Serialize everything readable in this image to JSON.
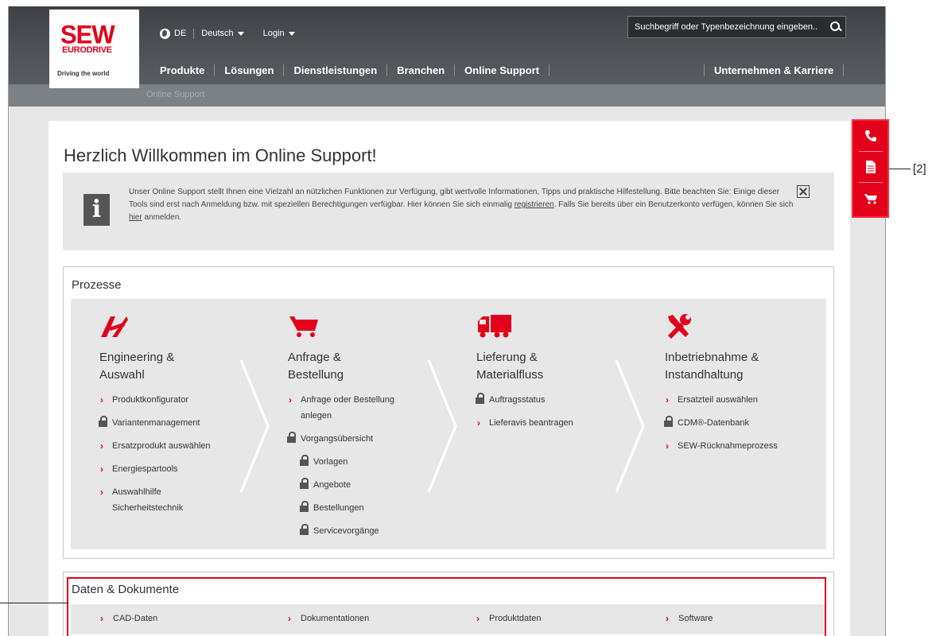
{
  "header": {
    "logo": {
      "brand": "SEW",
      "sub": "EURODRIVE",
      "tagline": "Driving the world"
    },
    "language_code": "DE",
    "language_label": "Deutsch",
    "login_label": "Login",
    "search_placeholder": "Suchbegriff oder Typenbezeichnung eingeben..",
    "nav": [
      "Produkte",
      "Lösungen",
      "Dienstleistungen",
      "Branchen",
      "Online Support"
    ],
    "nav_right": "Unternehmen & Karriere"
  },
  "breadcrumb": "Online Support",
  "side_tools": {
    "callout": "[2]",
    "icons": [
      "phone-icon",
      "document-icon",
      "cart-icon"
    ]
  },
  "main": {
    "title": "Herzlich Willkommen im Online Support!",
    "info": {
      "text_1": "Unser Online Support stellt Ihnen eine Vielzahl an nützlichen Funktionen zur Verfügung, gibt wertvolle Informationen, Tipps und praktische Hilfestellung. Bitte beachten Sie: Einige dieser Tools sind erst nach Anmeldung bzw. mit speziellen Berechtigungen verfügbar. Hier können Sie sich einmalig ",
      "link_register": "registrieren",
      "text_2": ". Falls Sie bereits über ein Benutzerkonto verfügen, können Sie sich ",
      "link_here": "hier",
      "text_3": " anmelden."
    },
    "processes": {
      "heading": "Prozesse",
      "columns": [
        {
          "title_1": "Engineering &",
          "title_2": "Auswahl",
          "items": [
            {
              "label": "Produktkonfigurator",
              "locked": false
            },
            {
              "label": "Variantenmanagement",
              "locked": true
            },
            {
              "label": "Ersatzprodukt auswählen",
              "locked": false
            },
            {
              "label": "Energiespartools",
              "locked": false
            },
            {
              "label": "Auswahlhilfe Sicherheitstechnik",
              "locked": false
            }
          ]
        },
        {
          "title_1": "Anfrage &",
          "title_2": "Bestellung",
          "items": [
            {
              "label": "Anfrage oder Bestellung anlegen",
              "locked": false
            },
            {
              "label": "Vorgangsübersicht",
              "locked": true
            },
            {
              "label": "Vorlagen",
              "locked": true,
              "indent": true
            },
            {
              "label": "Angebote",
              "locked": true,
              "indent": true
            },
            {
              "label": "Bestellungen",
              "locked": true,
              "indent": true
            },
            {
              "label": "Servicevorgänge",
              "locked": true,
              "indent": true
            }
          ]
        },
        {
          "title_1": "Lieferung &",
          "title_2": "Materialfluss",
          "items": [
            {
              "label": "Auftragsstatus",
              "locked": true
            },
            {
              "label": "Lieferavis beantragen",
              "locked": false
            }
          ]
        },
        {
          "title_1": "Inbetriebnahme &",
          "title_2": "Instandhaltung",
          "items": [
            {
              "label": "Ersatzteil auswählen",
              "locked": false
            },
            {
              "label": "CDM®-Datenbank",
              "locked": true
            },
            {
              "label": "SEW-Rücknahmeprozess",
              "locked": false
            }
          ]
        }
      ]
    },
    "documents": {
      "heading": "Daten & Dokumente",
      "links": [
        "CAD-Daten",
        "Dokumentationen",
        "Produktdaten",
        "Software"
      ]
    }
  },
  "colors": {
    "accent": "#e2001a",
    "header": "#4a4e53",
    "panel": "#e7e7e7"
  }
}
